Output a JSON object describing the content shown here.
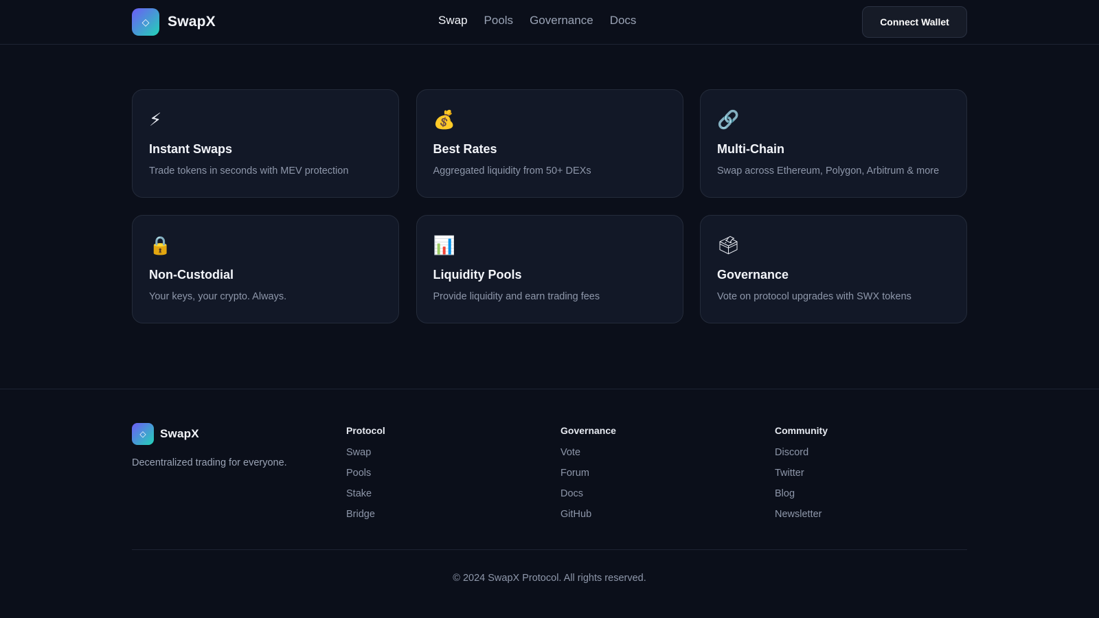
{
  "header": {
    "brand": "SwapX",
    "logo_glyph": "◇",
    "nav": [
      {
        "label": "Swap",
        "active": true
      },
      {
        "label": "Pools",
        "active": false
      },
      {
        "label": "Governance",
        "active": false
      },
      {
        "label": "Docs",
        "active": false
      }
    ],
    "connect_label": "Connect Wallet"
  },
  "features": [
    {
      "icon": "⚡",
      "icon_name": "lightning-icon",
      "title": "Instant Swaps",
      "desc": "Trade tokens in seconds with MEV protection"
    },
    {
      "icon": "💰",
      "icon_name": "money-bag-icon",
      "title": "Best Rates",
      "desc": "Aggregated liquidity from 50+ DEXs"
    },
    {
      "icon": "🔗",
      "icon_name": "link-icon",
      "title": "Multi-Chain",
      "desc": "Swap across Ethereum, Polygon, Arbitrum & more"
    },
    {
      "icon": "🔒",
      "icon_name": "lock-icon",
      "title": "Non-Custodial",
      "desc": "Your keys, your crypto. Always."
    },
    {
      "icon": "📊",
      "icon_name": "bar-chart-icon",
      "title": "Liquidity Pools",
      "desc": "Provide liquidity and earn trading fees"
    },
    {
      "icon": "🗳",
      "icon_name": "ballot-box-icon",
      "title": "Governance",
      "desc": "Vote on protocol upgrades with SWX tokens"
    }
  ],
  "footer": {
    "brand": "SwapX",
    "tagline": "Decentralized trading for everyone.",
    "columns": [
      {
        "title": "Protocol",
        "links": [
          "Swap",
          "Pools",
          "Stake",
          "Bridge"
        ]
      },
      {
        "title": "Governance",
        "links": [
          "Vote",
          "Forum",
          "Docs",
          "GitHub"
        ]
      },
      {
        "title": "Community",
        "links": [
          "Discord",
          "Twitter",
          "Blog",
          "Newsletter"
        ]
      }
    ],
    "copyright": "© 2024 SwapX Protocol. All rights reserved."
  },
  "colors": {
    "background": "#0b0f1a",
    "card": "#121827",
    "accent_start": "#6d5cf6",
    "accent_end": "#22d3b6"
  }
}
